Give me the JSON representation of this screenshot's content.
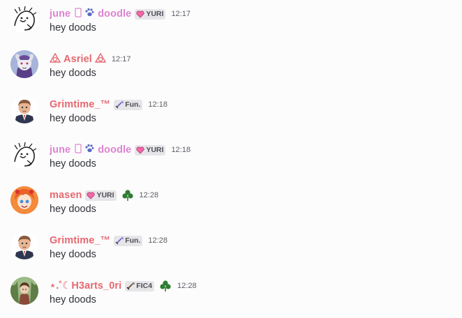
{
  "messages": [
    {
      "name_parts": [
        "june",
        "doodle"
      ],
      "name_color": "#e083d1",
      "name_icons": [
        "phone-outline-icon",
        "paw-icon"
      ],
      "badge": {
        "icon": "pink-heart-icon",
        "label": "YURI"
      },
      "has_clover": false,
      "time": "12:17",
      "text": "hey doods",
      "avatar": "sketch-avatar"
    },
    {
      "name": "Asriel",
      "name_prefix_icon": "trinity-triangle-icon",
      "name_suffix_icon": "trinity-triangle-icon",
      "name_color": "#e6686f",
      "time": "12:17",
      "text": "hey doods",
      "avatar": "goat-avatar"
    },
    {
      "name": "Grimtime_™",
      "name_color": "#e6686f",
      "badge": {
        "icon": "sword-icon",
        "label": "Fun."
      },
      "time": "12:18",
      "text": "hey doods",
      "avatar": "suit-avatar"
    },
    {
      "name_parts": [
        "june",
        "doodle"
      ],
      "name_color": "#e083d1",
      "name_icons": [
        "phone-outline-icon",
        "paw-icon"
      ],
      "badge": {
        "icon": "pink-heart-icon",
        "label": "YURI"
      },
      "time": "12:18",
      "text": "hey doods",
      "avatar": "sketch-avatar"
    },
    {
      "name": "masen",
      "name_color": "#e6686f",
      "badge": {
        "icon": "pink-heart-icon",
        "label": "YURI"
      },
      "has_clover": true,
      "time": "12:28",
      "text": "hey doods",
      "avatar": "orange-hair-avatar"
    },
    {
      "name": "Grimtime_™",
      "name_color": "#e6686f",
      "badge": {
        "icon": "sword-icon",
        "label": "Fun."
      },
      "time": "12:28",
      "text": "hey doods",
      "avatar": "suit-avatar"
    },
    {
      "name": "⋆.˚☾H3arts_0ri",
      "name_color": "#e6686f",
      "badge": {
        "icon": "dagger-icon",
        "label": "FIC4"
      },
      "has_clover": true,
      "time": "12:28",
      "text": "hey doods",
      "avatar": "forest-avatar"
    }
  ],
  "colors": {
    "background": "#fcfcfd",
    "badge_bg": "#e6e6e9",
    "text": "#313338",
    "timestamp": "#5c5e66",
    "clover": "#2e7d32"
  }
}
